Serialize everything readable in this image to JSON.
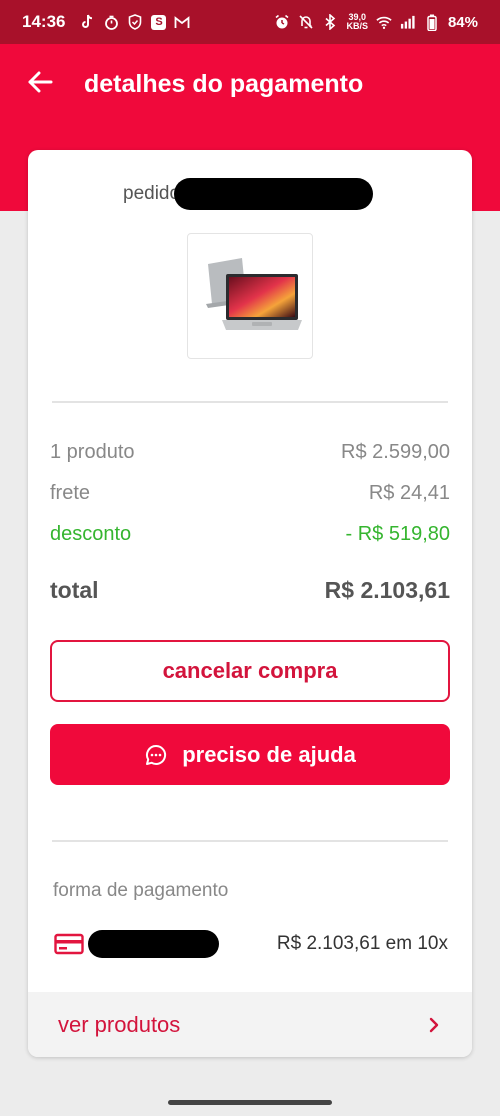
{
  "status_bar": {
    "time": "14:36",
    "app_icons": [
      "tiktok-icon",
      "timer-icon",
      "shield-icon",
      "s-app-icon",
      "gmail-icon"
    ],
    "s_box_letter": "S",
    "net_speed_value": "39,0",
    "net_speed_unit": "KB/S",
    "battery": "84%"
  },
  "header": {
    "title": "detalhes do pagamento"
  },
  "order": {
    "label": "pedido"
  },
  "summary": {
    "product_label": "1 produto",
    "product_value": "R$ 2.599,00",
    "shipping_label": "frete",
    "shipping_value": "R$ 24,41",
    "discount_label": "desconto",
    "discount_value": "- R$ 519,80",
    "total_label": "total",
    "total_value": "R$ 2.103,61"
  },
  "actions": {
    "cancel_label": "cancelar compra",
    "help_label": "preciso de ajuda"
  },
  "payment": {
    "section_label": "forma de pagamento",
    "amount": "R$ 2.103,61 em 10x"
  },
  "footer_link": {
    "label": "ver produtos"
  },
  "colors": {
    "brand_red": "#f0093b",
    "status_bar": "#a8112a",
    "discount_green": "#35b52f"
  }
}
